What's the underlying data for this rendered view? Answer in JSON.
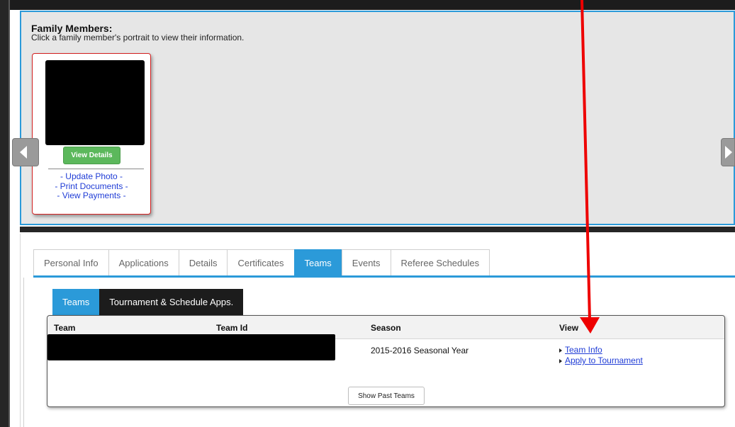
{
  "family": {
    "title": "Family Members:",
    "subtitle": "Click a family member's portrait to view their information.",
    "member_card": {
      "view_details_label": "View Details",
      "links": [
        "- Update Photo -",
        "- Print Documents -",
        "- View Payments -"
      ]
    }
  },
  "tabs": {
    "main": [
      "Personal Info",
      "Applications",
      "Details",
      "Certificates",
      "Teams",
      "Events",
      "Referee Schedules"
    ],
    "active": "Teams",
    "sub": [
      "Teams",
      "Tournament & Schedule Apps."
    ]
  },
  "teams_table": {
    "columns": [
      "Team",
      "Team Id",
      "Season",
      "View"
    ],
    "rows": [
      {
        "season": "2015-2016 Seasonal Year",
        "links": [
          "Team Info",
          "Apply to Tournament"
        ]
      }
    ],
    "show_past_label": "Show Past Teams"
  },
  "colors": {
    "accent": "#2b9ad9",
    "view_button": "#5cb85c",
    "card_border": "#d32020",
    "annotation_arrow": "#ee0000"
  },
  "icons": {
    "prev": "chevron-left-icon",
    "next": "chevron-right-icon",
    "annotation": "red-arrow-annotation"
  }
}
